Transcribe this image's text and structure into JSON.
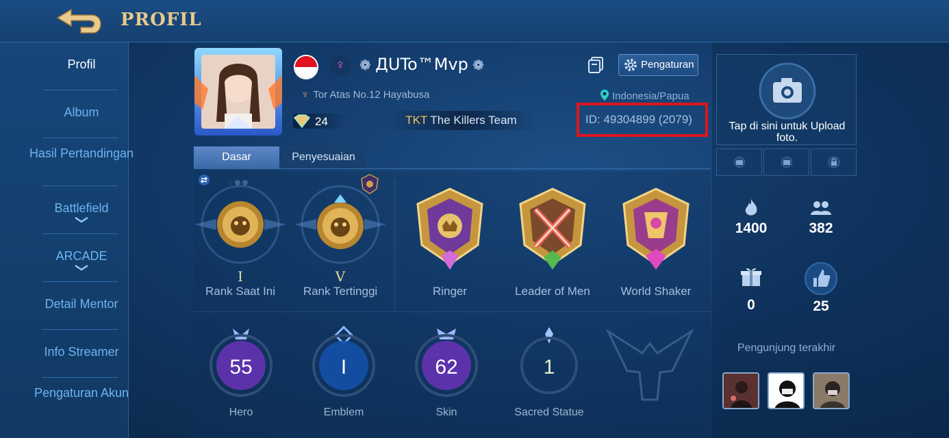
{
  "header": {
    "title": "PROFIL",
    "back_icon": "back-arrow-icon"
  },
  "sidebar": {
    "items": [
      {
        "label": "Profil",
        "active": true
      },
      {
        "label": "Album"
      },
      {
        "label": "Hasil Pertandingan"
      },
      {
        "label": "Battlefield",
        "icon": "chevron-down-icon"
      },
      {
        "label": "ARCADE",
        "icon": "chevron-down-icon"
      },
      {
        "label": "Detail Mentor"
      },
      {
        "label": "Info Streamer"
      },
      {
        "label": "Pengaturan Akun"
      }
    ]
  },
  "profile": {
    "name": "ДUTo™Mvp",
    "title": "Tor Atas No.12 Hayabusa",
    "level": "24",
    "team_tag": "TKT",
    "team_name": "The Killers Team",
    "location": "Indonesia/Papua",
    "id_text": "ID: 49304899 (2079)",
    "settings_label": "Pengaturan",
    "flag": "indonesia-flag",
    "gender_symbol": "♀"
  },
  "tabs": [
    {
      "label": "Dasar",
      "active": true
    },
    {
      "label": "Penyesuaian"
    }
  ],
  "badges": [
    {
      "label": "Rank Saat Ini",
      "roman": "I"
    },
    {
      "label": "Rank Tertinggi",
      "roman": "V"
    },
    {
      "label": "Ringer"
    },
    {
      "label": "Leader of Men"
    },
    {
      "label": "World Shaker"
    }
  ],
  "stats": [
    {
      "label": "Hero",
      "value": "55",
      "color": "#7b3fd6"
    },
    {
      "label": "Emblem",
      "value": "I",
      "color": "#1f74d6"
    },
    {
      "label": "Skin",
      "value": "62",
      "color": "#7b3fd6"
    },
    {
      "label": "Sacred Statue",
      "value": "1",
      "color": "#6a86a8"
    }
  ],
  "right": {
    "upload_text": "Tap di sini untuk Upload foto.",
    "metrics": [
      {
        "icon": "flame-icon",
        "value": "1400"
      },
      {
        "icon": "friends-icon",
        "value": "382"
      },
      {
        "icon": "gift-icon",
        "value": "0"
      },
      {
        "icon": "thumbs-up-icon",
        "value": "25"
      }
    ],
    "visitors_label": "Pengunjung terakhir"
  },
  "colors": {
    "id_highlight": "#e0141c",
    "accent_gold": "#e9c98c",
    "link_blue": "#6cb4f0"
  }
}
